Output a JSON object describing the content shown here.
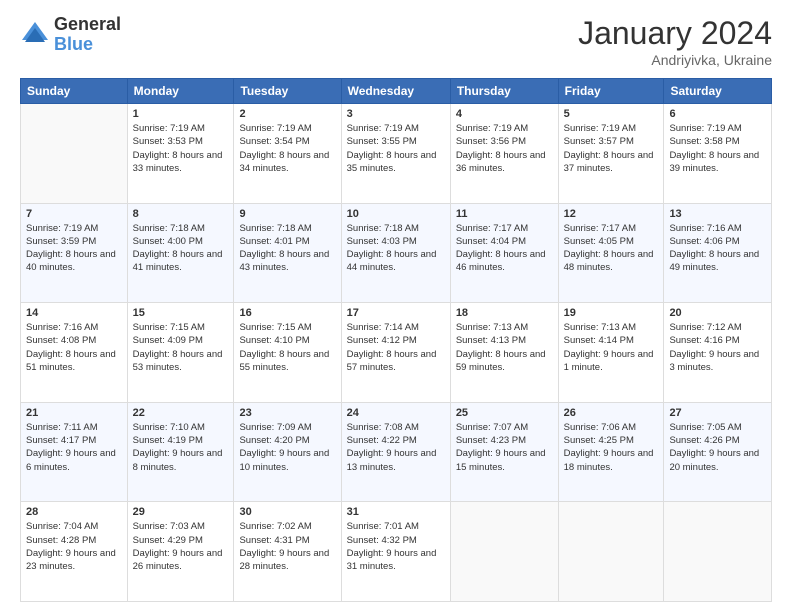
{
  "logo": {
    "general": "General",
    "blue": "Blue"
  },
  "title": "January 2024",
  "location": "Andriyivka, Ukraine",
  "header_days": [
    "Sunday",
    "Monday",
    "Tuesday",
    "Wednesday",
    "Thursday",
    "Friday",
    "Saturday"
  ],
  "weeks": [
    [
      {
        "day": "",
        "sunrise": "",
        "sunset": "",
        "daylight": ""
      },
      {
        "day": "1",
        "sunrise": "7:19 AM",
        "sunset": "3:53 PM",
        "daylight": "8 hours and 33 minutes."
      },
      {
        "day": "2",
        "sunrise": "7:19 AM",
        "sunset": "3:54 PM",
        "daylight": "8 hours and 34 minutes."
      },
      {
        "day": "3",
        "sunrise": "7:19 AM",
        "sunset": "3:55 PM",
        "daylight": "8 hours and 35 minutes."
      },
      {
        "day": "4",
        "sunrise": "7:19 AM",
        "sunset": "3:56 PM",
        "daylight": "8 hours and 36 minutes."
      },
      {
        "day": "5",
        "sunrise": "7:19 AM",
        "sunset": "3:57 PM",
        "daylight": "8 hours and 37 minutes."
      },
      {
        "day": "6",
        "sunrise": "7:19 AM",
        "sunset": "3:58 PM",
        "daylight": "8 hours and 39 minutes."
      }
    ],
    [
      {
        "day": "7",
        "sunrise": "7:19 AM",
        "sunset": "3:59 PM",
        "daylight": "8 hours and 40 minutes."
      },
      {
        "day": "8",
        "sunrise": "7:18 AM",
        "sunset": "4:00 PM",
        "daylight": "8 hours and 41 minutes."
      },
      {
        "day": "9",
        "sunrise": "7:18 AM",
        "sunset": "4:01 PM",
        "daylight": "8 hours and 43 minutes."
      },
      {
        "day": "10",
        "sunrise": "7:18 AM",
        "sunset": "4:03 PM",
        "daylight": "8 hours and 44 minutes."
      },
      {
        "day": "11",
        "sunrise": "7:17 AM",
        "sunset": "4:04 PM",
        "daylight": "8 hours and 46 minutes."
      },
      {
        "day": "12",
        "sunrise": "7:17 AM",
        "sunset": "4:05 PM",
        "daylight": "8 hours and 48 minutes."
      },
      {
        "day": "13",
        "sunrise": "7:16 AM",
        "sunset": "4:06 PM",
        "daylight": "8 hours and 49 minutes."
      }
    ],
    [
      {
        "day": "14",
        "sunrise": "7:16 AM",
        "sunset": "4:08 PM",
        "daylight": "8 hours and 51 minutes."
      },
      {
        "day": "15",
        "sunrise": "7:15 AM",
        "sunset": "4:09 PM",
        "daylight": "8 hours and 53 minutes."
      },
      {
        "day": "16",
        "sunrise": "7:15 AM",
        "sunset": "4:10 PM",
        "daylight": "8 hours and 55 minutes."
      },
      {
        "day": "17",
        "sunrise": "7:14 AM",
        "sunset": "4:12 PM",
        "daylight": "8 hours and 57 minutes."
      },
      {
        "day": "18",
        "sunrise": "7:13 AM",
        "sunset": "4:13 PM",
        "daylight": "8 hours and 59 minutes."
      },
      {
        "day": "19",
        "sunrise": "7:13 AM",
        "sunset": "4:14 PM",
        "daylight": "9 hours and 1 minute."
      },
      {
        "day": "20",
        "sunrise": "7:12 AM",
        "sunset": "4:16 PM",
        "daylight": "9 hours and 3 minutes."
      }
    ],
    [
      {
        "day": "21",
        "sunrise": "7:11 AM",
        "sunset": "4:17 PM",
        "daylight": "9 hours and 6 minutes."
      },
      {
        "day": "22",
        "sunrise": "7:10 AM",
        "sunset": "4:19 PM",
        "daylight": "9 hours and 8 minutes."
      },
      {
        "day": "23",
        "sunrise": "7:09 AM",
        "sunset": "4:20 PM",
        "daylight": "9 hours and 10 minutes."
      },
      {
        "day": "24",
        "sunrise": "7:08 AM",
        "sunset": "4:22 PM",
        "daylight": "9 hours and 13 minutes."
      },
      {
        "day": "25",
        "sunrise": "7:07 AM",
        "sunset": "4:23 PM",
        "daylight": "9 hours and 15 minutes."
      },
      {
        "day": "26",
        "sunrise": "7:06 AM",
        "sunset": "4:25 PM",
        "daylight": "9 hours and 18 minutes."
      },
      {
        "day": "27",
        "sunrise": "7:05 AM",
        "sunset": "4:26 PM",
        "daylight": "9 hours and 20 minutes."
      }
    ],
    [
      {
        "day": "28",
        "sunrise": "7:04 AM",
        "sunset": "4:28 PM",
        "daylight": "9 hours and 23 minutes."
      },
      {
        "day": "29",
        "sunrise": "7:03 AM",
        "sunset": "4:29 PM",
        "daylight": "9 hours and 26 minutes."
      },
      {
        "day": "30",
        "sunrise": "7:02 AM",
        "sunset": "4:31 PM",
        "daylight": "9 hours and 28 minutes."
      },
      {
        "day": "31",
        "sunrise": "7:01 AM",
        "sunset": "4:32 PM",
        "daylight": "9 hours and 31 minutes."
      },
      {
        "day": "",
        "sunrise": "",
        "sunset": "",
        "daylight": ""
      },
      {
        "day": "",
        "sunrise": "",
        "sunset": "",
        "daylight": ""
      },
      {
        "day": "",
        "sunrise": "",
        "sunset": "",
        "daylight": ""
      }
    ]
  ]
}
